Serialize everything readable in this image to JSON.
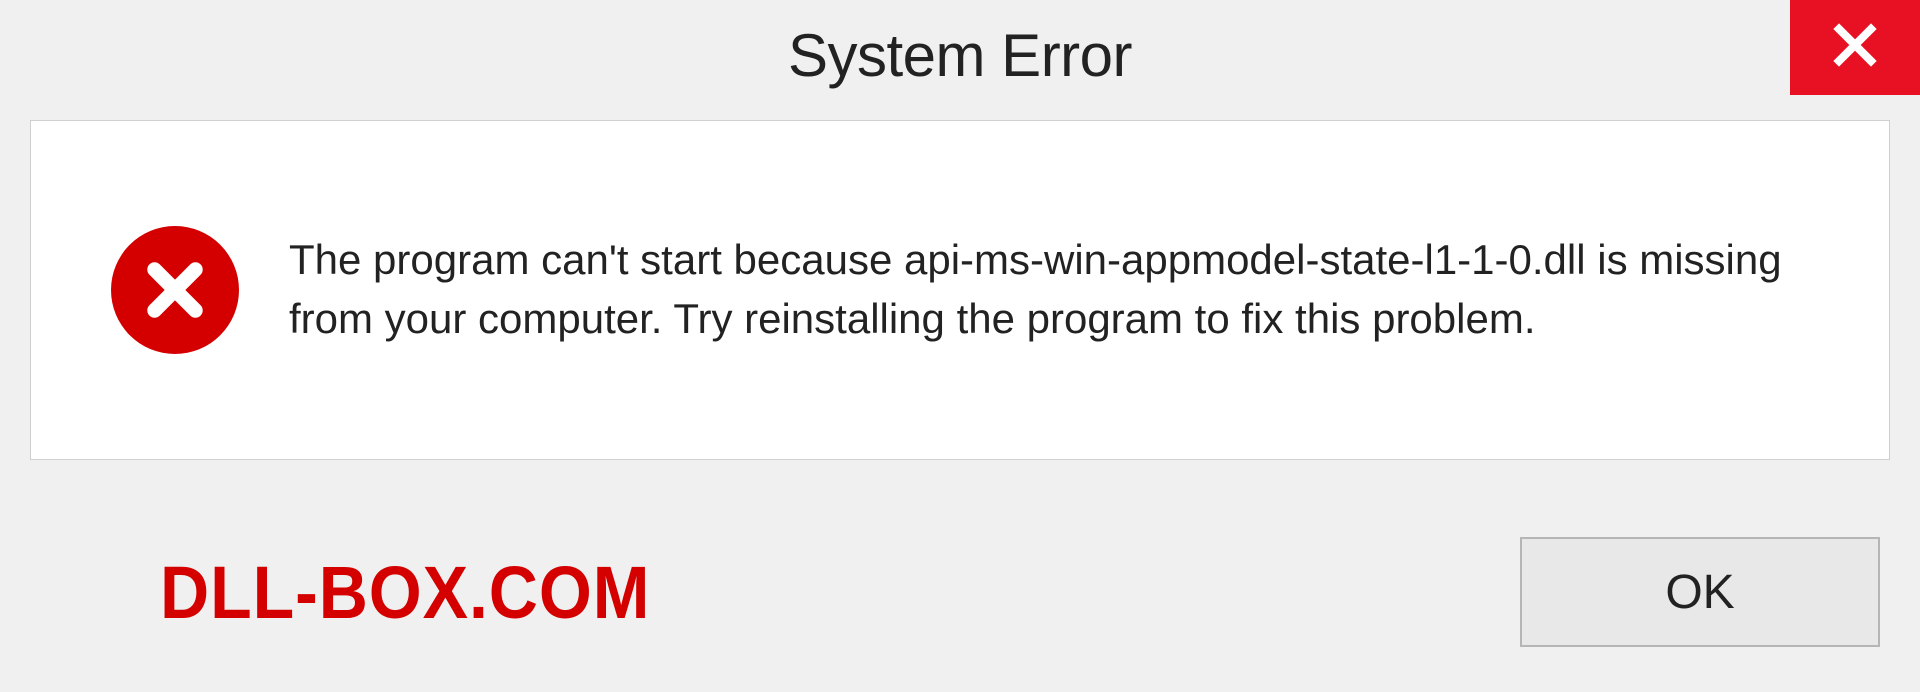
{
  "dialog": {
    "title": "System Error",
    "message": "The program can't start because api-ms-win-appmodel-state-l1-1-0.dll is missing from your computer. Try reinstalling the program to fix this problem.",
    "ok_label": "OK",
    "watermark": "DLL-BOX.COM"
  },
  "colors": {
    "close_bg": "#e81123",
    "error_icon_bg": "#d40000",
    "watermark_color": "#d40000"
  }
}
